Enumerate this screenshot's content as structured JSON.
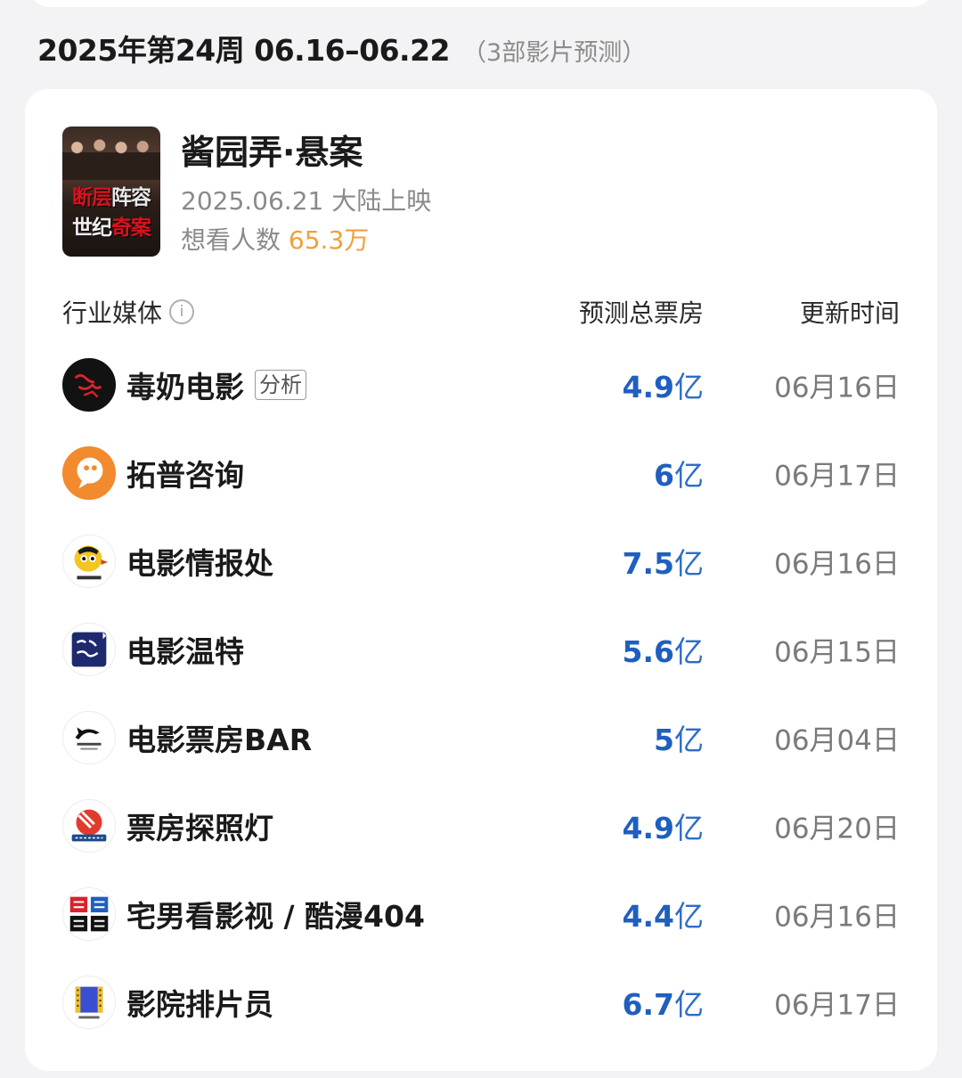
{
  "week": {
    "title": "2025年第24周 06.16–06.22",
    "note": "（3部影片预测）"
  },
  "movie": {
    "title": "酱园弄·悬案",
    "release": "2025.06.21 大陆上映",
    "want_label": "想看人数",
    "want_value": "65.3万",
    "poster": {
      "line1_a": "断层",
      "line1_b": "阵容",
      "line2_a": "世纪",
      "line2_b": "奇案"
    }
  },
  "table": {
    "headers": {
      "media": "行业媒体",
      "total": "预测总票房",
      "time": "更新时间"
    },
    "rows": [
      {
        "name": "毒奶电影",
        "tag": "分析",
        "value": "4.9",
        "unit": "亿",
        "date": "06月16日",
        "logo": "dunai-logo-icon"
      },
      {
        "name": "拓普咨询",
        "tag": "",
        "value": "6",
        "unit": "亿",
        "date": "06月17日",
        "logo": "topu-logo-icon"
      },
      {
        "name": "电影情报处",
        "tag": "",
        "value": "7.5",
        "unit": "亿",
        "date": "06月16日",
        "logo": "qingbaochu-logo-icon"
      },
      {
        "name": "电影温特",
        "tag": "",
        "value": "5.6",
        "unit": "亿",
        "date": "06月15日",
        "logo": "wente-logo-icon"
      },
      {
        "name": "电影票房BAR",
        "tag": "",
        "value": "5",
        "unit": "亿",
        "date": "06月04日",
        "logo": "piaofangbar-logo-icon"
      },
      {
        "name": "票房探照灯",
        "tag": "",
        "value": "4.9",
        "unit": "亿",
        "date": "06月20日",
        "logo": "tanzhaodeng-logo-icon"
      },
      {
        "name": "宅男看影视 / 酷漫404",
        "tag": "",
        "value": "4.4",
        "unit": "亿",
        "date": "06月16日",
        "logo": "kuman-logo-icon"
      },
      {
        "name": "影院排片员",
        "tag": "",
        "value": "6.7",
        "unit": "亿",
        "date": "06月17日",
        "logo": "paipianyuan-logo-icon"
      }
    ]
  },
  "colors": {
    "value_blue": "#1f5fbf",
    "want_orange": "#f0a03a",
    "poster_red": "#d8121d"
  }
}
